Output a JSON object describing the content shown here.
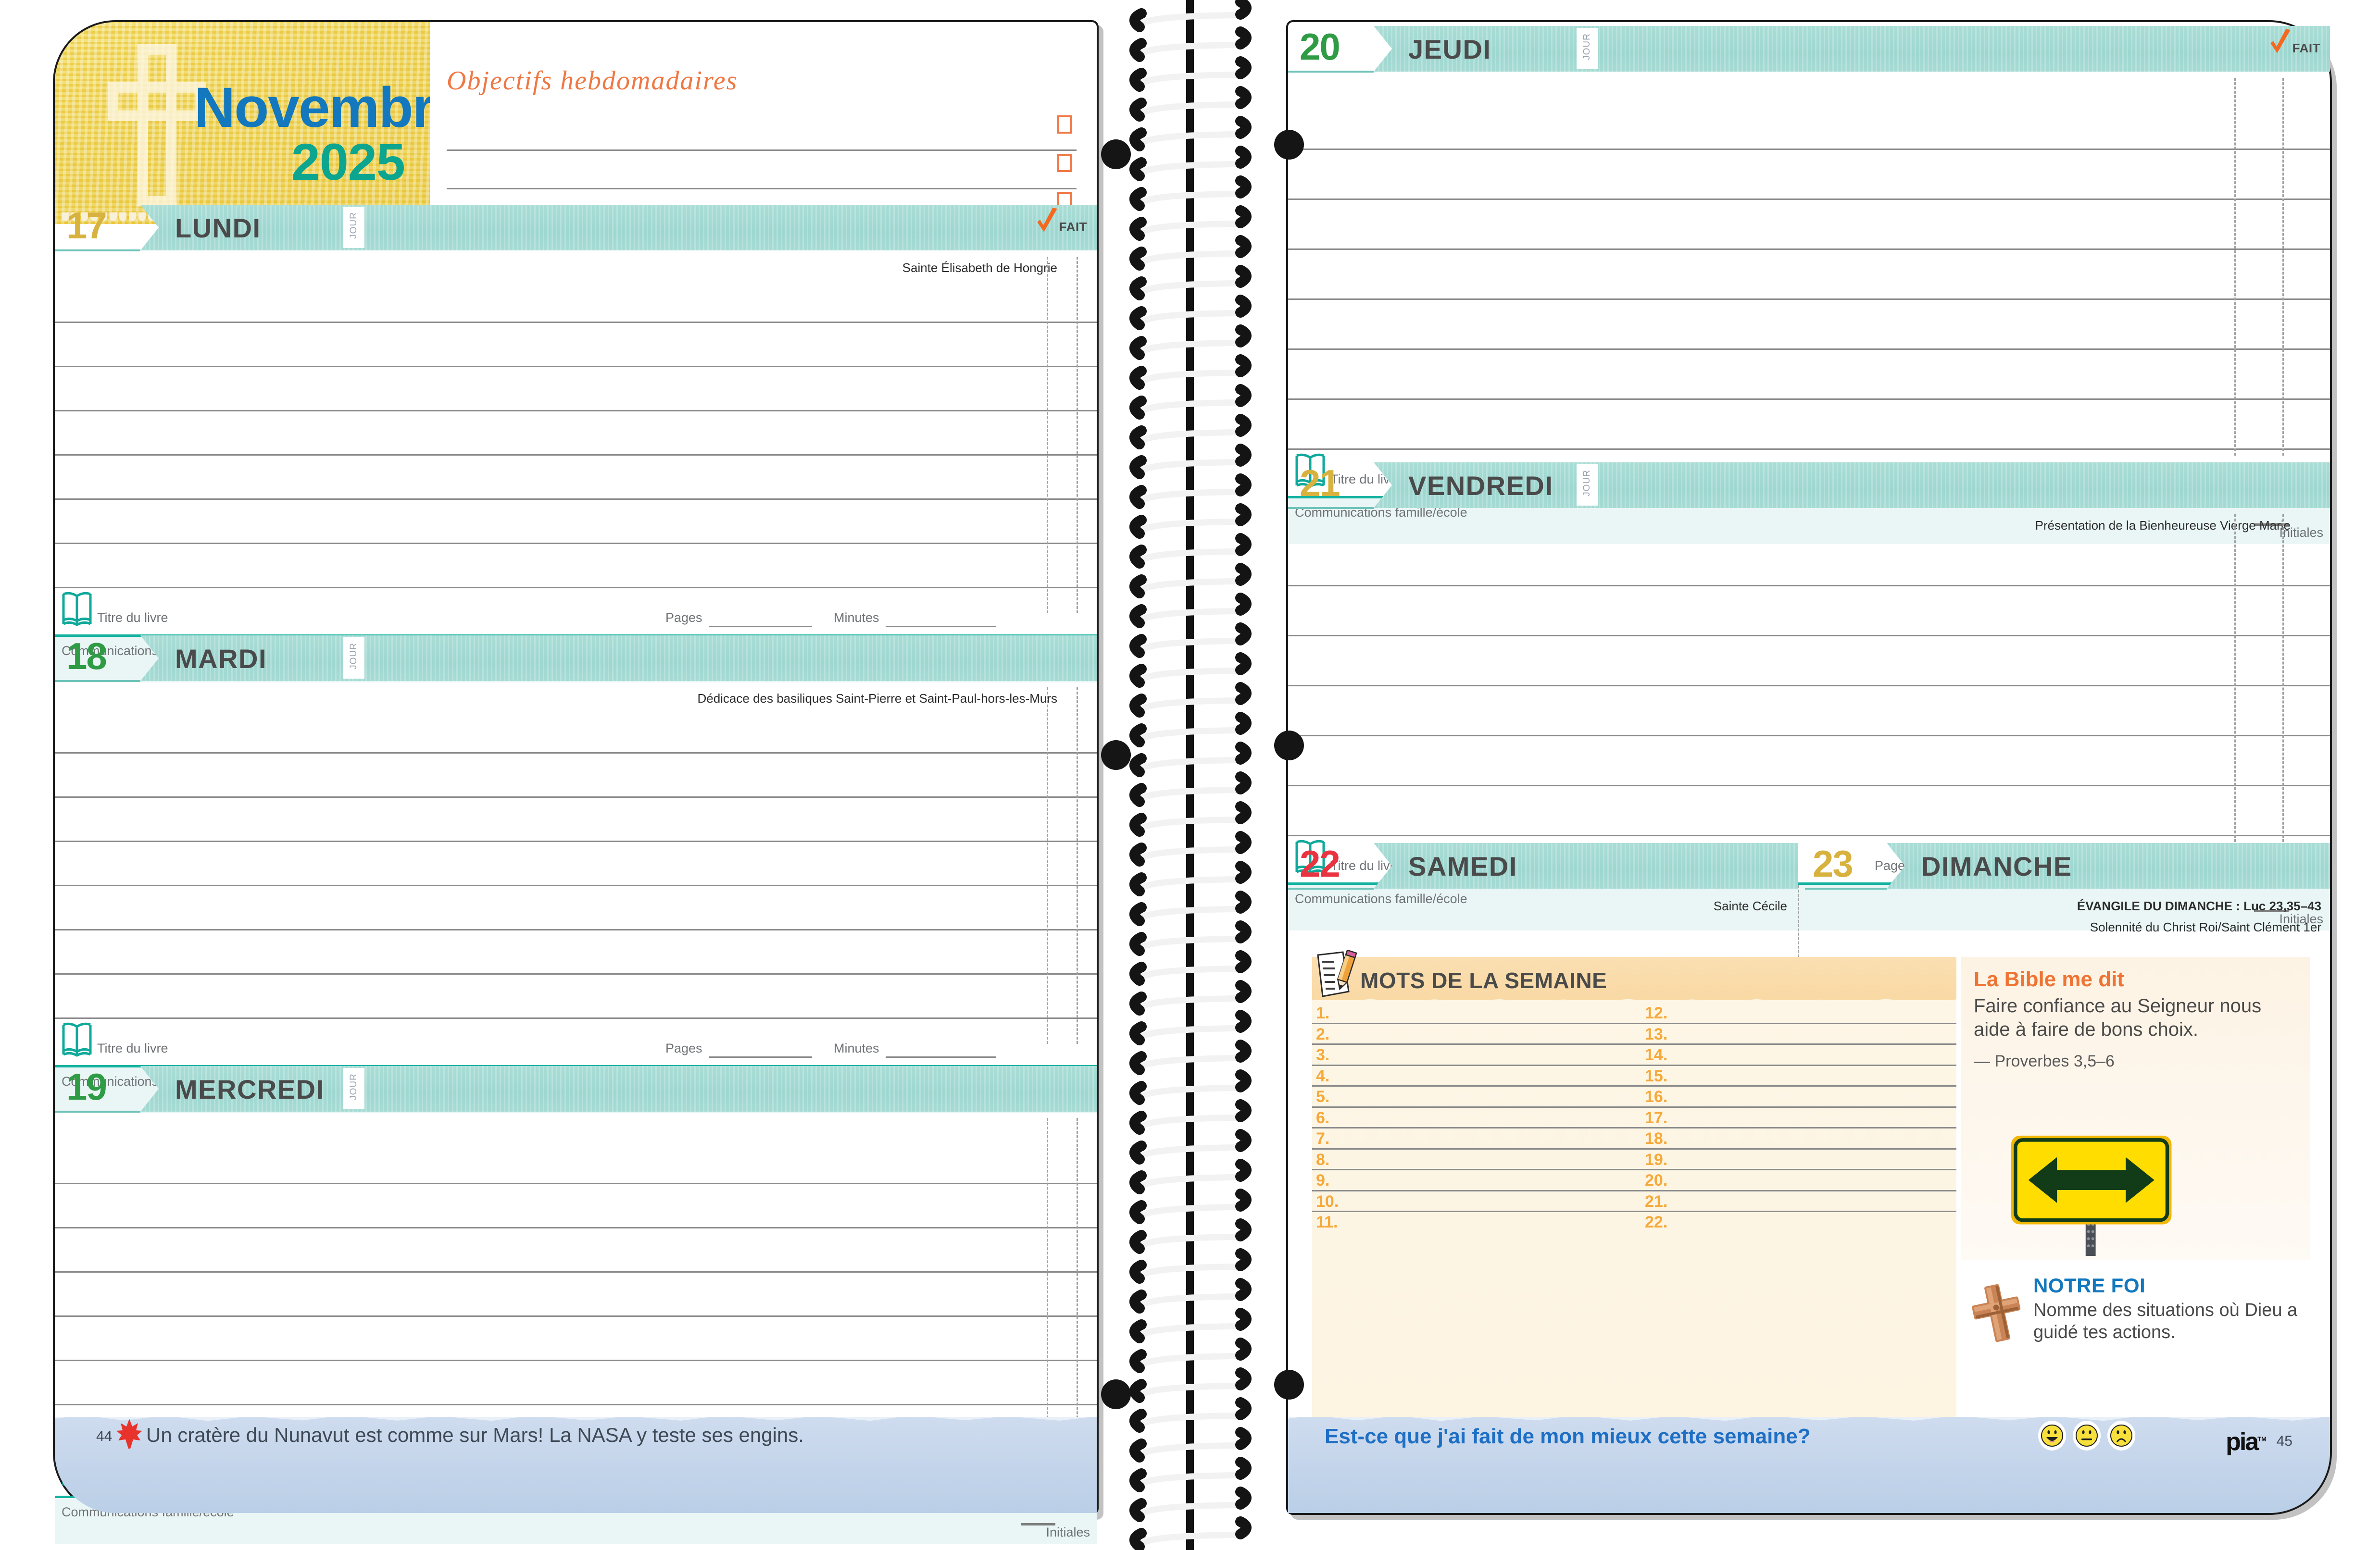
{
  "month": {
    "name": "Novembre",
    "year": "2025"
  },
  "objectives": {
    "title": "Objectifs hebdomadaires",
    "rows": [
      "",
      "",
      ""
    ]
  },
  "labels": {
    "jour": "JOUR",
    "fait": "FAIT",
    "book_title": "Titre du livre",
    "pages": "Pages",
    "minutes": "Minutes",
    "communications": "Communications famille/école",
    "initiales": "Initiales"
  },
  "days": [
    {
      "num": "17",
      "name": "LUNDI",
      "num_color": "#d8b23f",
      "fait": true,
      "saint": "Sainte Élisabeth de Hongrie",
      "lines": 7
    },
    {
      "num": "18",
      "name": "MARDI",
      "num_color": "#2f9b45",
      "fait": false,
      "saint": "Dédicace des basiliques Saint-Pierre et Saint-Paul-hors-les-Murs",
      "lines": 7
    },
    {
      "num": "19",
      "name": "MERCREDI",
      "num_color": "#2f9b45",
      "fait": false,
      "saint": "",
      "lines": 7
    },
    {
      "num": "20",
      "name": "JEUDI",
      "num_color": "#2f9b45",
      "fait": true,
      "saint": "",
      "lines": 7
    },
    {
      "num": "21",
      "name": "VENDREDI",
      "num_color": "#d8b23f",
      "fait": false,
      "saint": "Présentation de la Bienheureuse Vierge Marie",
      "lines": 6
    }
  ],
  "weekend": {
    "saturday": {
      "num": "22",
      "name": "SAMEDI",
      "num_color": "#ea3340",
      "saint": "Sainte Cécile"
    },
    "sunday": {
      "num": "23",
      "name": "DIMANCHE",
      "num_color": "#d8b23f",
      "gospel": "ÉVANGILE DU DIMANCHE : Luc 23,35–43",
      "solemnity": "Solennité du Christ Roi/Saint Clément 1er"
    }
  },
  "mots": {
    "title": "MOTS DE LA SEMAINE",
    "left_numbers": [
      "1.",
      "2.",
      "3.",
      "4.",
      "5.",
      "6.",
      "7.",
      "8.",
      "9.",
      "10.",
      "11."
    ],
    "right_numbers": [
      "12.",
      "13.",
      "14.",
      "15.",
      "16.",
      "17.",
      "18.",
      "19.",
      "20.",
      "21.",
      "22."
    ]
  },
  "bible": {
    "title": "La Bible me dit",
    "text": "Faire confiance au Seigneur nous aide à faire de bons choix.",
    "reference": "— Proverbes 3,5–6",
    "image": "two-way-arrow-road-sign"
  },
  "faith": {
    "title": "NOTRE FOI",
    "text": "Nomme des situations où Dieu a guidé tes actions.",
    "icon": "wooden-cross-icon"
  },
  "footers": {
    "left": {
      "page": "44",
      "icon": "maple-leaf-icon",
      "fact": "Un cratère du Nunavut est comme sur Mars! La NASA y teste ses engins."
    },
    "right": {
      "page": "45",
      "question": "Est-ce que j'ai fait de mon mieux cette semaine?",
      "brand": "pia",
      "faces": [
        "happy-face-icon",
        "neutral-face-icon",
        "sad-face-icon"
      ]
    }
  },
  "colors": {
    "band_teal": "#a9ddd6",
    "accent_orange": "#ef7434",
    "blue": "#1378bd",
    "teal": "#0ca58f",
    "gold": "#d8b23f",
    "green": "#2f9b45",
    "red": "#ea3340",
    "mots_cream": "#fdf6e6",
    "mots_head": "#fbdfb2",
    "footer_blue": "#c3d4ea"
  }
}
